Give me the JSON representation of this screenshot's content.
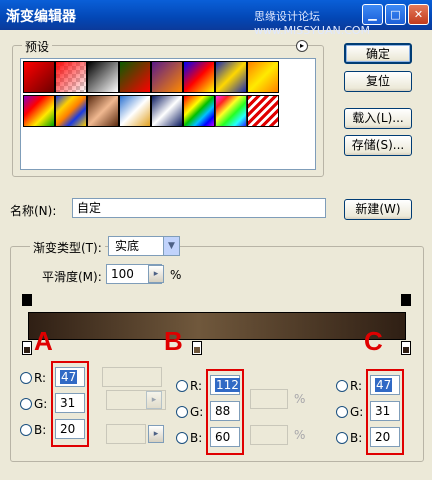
{
  "window": {
    "title": "渐变编辑器",
    "watermark": "思缘设计论坛 www.MISSYUAN.COM"
  },
  "presets": {
    "label": "预设",
    "menu_glyph": "▸"
  },
  "buttons": {
    "ok": "确定",
    "reset": "复位",
    "load": "载入(L)...",
    "save": "存储(S)...",
    "new": "新建(W)"
  },
  "name": {
    "label": "名称(N):",
    "value": "自定"
  },
  "gradient": {
    "type_label": "渐变类型(T):",
    "type_value": "实底",
    "smooth_label": "平滑度(M):",
    "smooth_value": "100",
    "smooth_unit": "%"
  },
  "colors": {
    "left": {
      "r": "47",
      "g": "31",
      "b": "20"
    },
    "mid": {
      "r": "112",
      "g": "88",
      "b": "60"
    },
    "right": {
      "r": "47",
      "g": "31",
      "b": "20"
    }
  },
  "channel_labels": {
    "r": "R:",
    "g": "G:",
    "b": "B:"
  },
  "annotations": {
    "a": "A",
    "b": "B",
    "c": "C"
  },
  "percent": "%",
  "accent": "#e00000",
  "gradient_colors": [
    "#2f1f14",
    "#70583c",
    "#2f1f14"
  ]
}
